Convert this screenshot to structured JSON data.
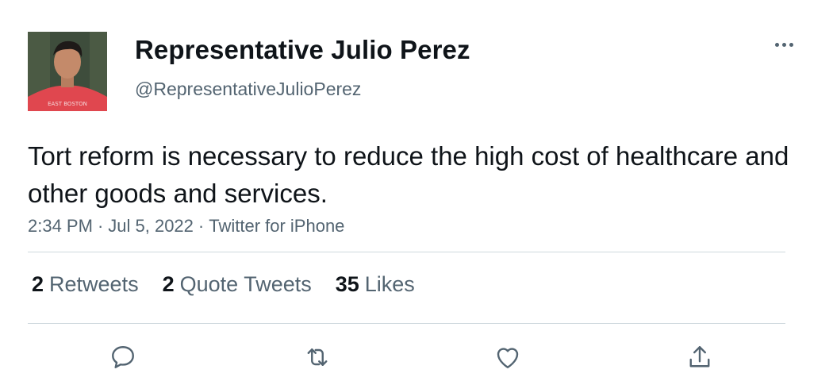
{
  "user": {
    "display_name": "Representative Julio Perez",
    "handle": "@RepresentativeJulioPerez",
    "shirt_text": "EAST BOSTON"
  },
  "tweet": {
    "text": "Tort reform is necessary to reduce the high cost of healthcare and other goods and services.",
    "time": "2:34 PM",
    "date": "Jul 5, 2022",
    "source": "Twitter for iPhone",
    "separator": "·"
  },
  "stats": {
    "retweets": {
      "count": "2",
      "label": "Retweets"
    },
    "quote_tweets": {
      "count": "2",
      "label": "Quote Tweets"
    },
    "likes": {
      "count": "35",
      "label": "Likes"
    }
  },
  "icons": {
    "reply": "reply-icon",
    "retweet": "retweet-icon",
    "like": "like-icon",
    "share": "share-icon",
    "more": "more-icon"
  },
  "colors": {
    "primary_text": "#0f1419",
    "secondary_text": "#536471",
    "divider": "#cfd9de",
    "icon": "#536471"
  }
}
